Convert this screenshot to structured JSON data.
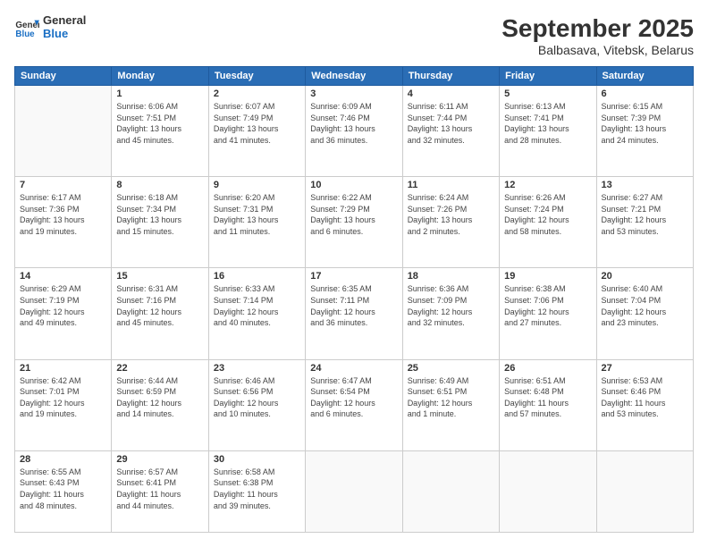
{
  "logo": {
    "text_general": "General",
    "text_blue": "Blue"
  },
  "title": "September 2025",
  "location": "Balbasava, Vitebsk, Belarus",
  "days_of_week": [
    "Sunday",
    "Monday",
    "Tuesday",
    "Wednesday",
    "Thursday",
    "Friday",
    "Saturday"
  ],
  "weeks": [
    [
      {
        "day": "",
        "info": ""
      },
      {
        "day": "1",
        "info": "Sunrise: 6:06 AM\nSunset: 7:51 PM\nDaylight: 13 hours\nand 45 minutes."
      },
      {
        "day": "2",
        "info": "Sunrise: 6:07 AM\nSunset: 7:49 PM\nDaylight: 13 hours\nand 41 minutes."
      },
      {
        "day": "3",
        "info": "Sunrise: 6:09 AM\nSunset: 7:46 PM\nDaylight: 13 hours\nand 36 minutes."
      },
      {
        "day": "4",
        "info": "Sunrise: 6:11 AM\nSunset: 7:44 PM\nDaylight: 13 hours\nand 32 minutes."
      },
      {
        "day": "5",
        "info": "Sunrise: 6:13 AM\nSunset: 7:41 PM\nDaylight: 13 hours\nand 28 minutes."
      },
      {
        "day": "6",
        "info": "Sunrise: 6:15 AM\nSunset: 7:39 PM\nDaylight: 13 hours\nand 24 minutes."
      }
    ],
    [
      {
        "day": "7",
        "info": "Sunrise: 6:17 AM\nSunset: 7:36 PM\nDaylight: 13 hours\nand 19 minutes."
      },
      {
        "day": "8",
        "info": "Sunrise: 6:18 AM\nSunset: 7:34 PM\nDaylight: 13 hours\nand 15 minutes."
      },
      {
        "day": "9",
        "info": "Sunrise: 6:20 AM\nSunset: 7:31 PM\nDaylight: 13 hours\nand 11 minutes."
      },
      {
        "day": "10",
        "info": "Sunrise: 6:22 AM\nSunset: 7:29 PM\nDaylight: 13 hours\nand 6 minutes."
      },
      {
        "day": "11",
        "info": "Sunrise: 6:24 AM\nSunset: 7:26 PM\nDaylight: 13 hours\nand 2 minutes."
      },
      {
        "day": "12",
        "info": "Sunrise: 6:26 AM\nSunset: 7:24 PM\nDaylight: 12 hours\nand 58 minutes."
      },
      {
        "day": "13",
        "info": "Sunrise: 6:27 AM\nSunset: 7:21 PM\nDaylight: 12 hours\nand 53 minutes."
      }
    ],
    [
      {
        "day": "14",
        "info": "Sunrise: 6:29 AM\nSunset: 7:19 PM\nDaylight: 12 hours\nand 49 minutes."
      },
      {
        "day": "15",
        "info": "Sunrise: 6:31 AM\nSunset: 7:16 PM\nDaylight: 12 hours\nand 45 minutes."
      },
      {
        "day": "16",
        "info": "Sunrise: 6:33 AM\nSunset: 7:14 PM\nDaylight: 12 hours\nand 40 minutes."
      },
      {
        "day": "17",
        "info": "Sunrise: 6:35 AM\nSunset: 7:11 PM\nDaylight: 12 hours\nand 36 minutes."
      },
      {
        "day": "18",
        "info": "Sunrise: 6:36 AM\nSunset: 7:09 PM\nDaylight: 12 hours\nand 32 minutes."
      },
      {
        "day": "19",
        "info": "Sunrise: 6:38 AM\nSunset: 7:06 PM\nDaylight: 12 hours\nand 27 minutes."
      },
      {
        "day": "20",
        "info": "Sunrise: 6:40 AM\nSunset: 7:04 PM\nDaylight: 12 hours\nand 23 minutes."
      }
    ],
    [
      {
        "day": "21",
        "info": "Sunrise: 6:42 AM\nSunset: 7:01 PM\nDaylight: 12 hours\nand 19 minutes."
      },
      {
        "day": "22",
        "info": "Sunrise: 6:44 AM\nSunset: 6:59 PM\nDaylight: 12 hours\nand 14 minutes."
      },
      {
        "day": "23",
        "info": "Sunrise: 6:46 AM\nSunset: 6:56 PM\nDaylight: 12 hours\nand 10 minutes."
      },
      {
        "day": "24",
        "info": "Sunrise: 6:47 AM\nSunset: 6:54 PM\nDaylight: 12 hours\nand 6 minutes."
      },
      {
        "day": "25",
        "info": "Sunrise: 6:49 AM\nSunset: 6:51 PM\nDaylight: 12 hours\nand 1 minute."
      },
      {
        "day": "26",
        "info": "Sunrise: 6:51 AM\nSunset: 6:48 PM\nDaylight: 11 hours\nand 57 minutes."
      },
      {
        "day": "27",
        "info": "Sunrise: 6:53 AM\nSunset: 6:46 PM\nDaylight: 11 hours\nand 53 minutes."
      }
    ],
    [
      {
        "day": "28",
        "info": "Sunrise: 6:55 AM\nSunset: 6:43 PM\nDaylight: 11 hours\nand 48 minutes."
      },
      {
        "day": "29",
        "info": "Sunrise: 6:57 AM\nSunset: 6:41 PM\nDaylight: 11 hours\nand 44 minutes."
      },
      {
        "day": "30",
        "info": "Sunrise: 6:58 AM\nSunset: 6:38 PM\nDaylight: 11 hours\nand 39 minutes."
      },
      {
        "day": "",
        "info": ""
      },
      {
        "day": "",
        "info": ""
      },
      {
        "day": "",
        "info": ""
      },
      {
        "day": "",
        "info": ""
      }
    ]
  ]
}
